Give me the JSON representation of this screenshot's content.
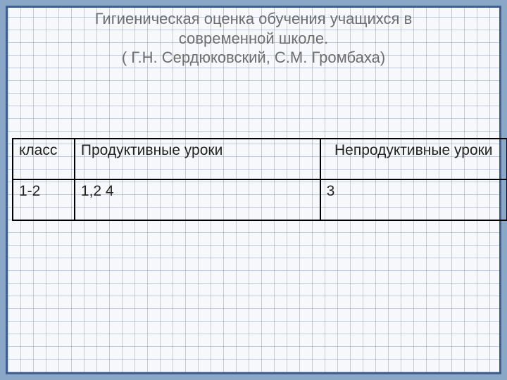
{
  "title_line1": "Гигиеническая оценка обучения учащихся в",
  "title_line2": "современной школе.",
  "title_line3": "( Г.Н. Сердюковский, С.М. Громбаха)",
  "table": {
    "headers": {
      "col1": "класс",
      "col2": "Продуктивные уроки",
      "col3": "Непродуктивные уроки"
    },
    "rows": [
      {
        "col1": "1-2",
        "col2": "1,2  4",
        "col3": "3"
      }
    ]
  },
  "chart_data": {
    "type": "table",
    "title": "Гигиеническая оценка обучения учащихся в современной школе. ( Г.Н. Сердюковский, С.М. Громбаха)",
    "columns": [
      "класс",
      "Продуктивные уроки",
      "Непродуктивные уроки"
    ],
    "rows": [
      [
        "1-2",
        "1,2  4",
        "3"
      ]
    ]
  }
}
